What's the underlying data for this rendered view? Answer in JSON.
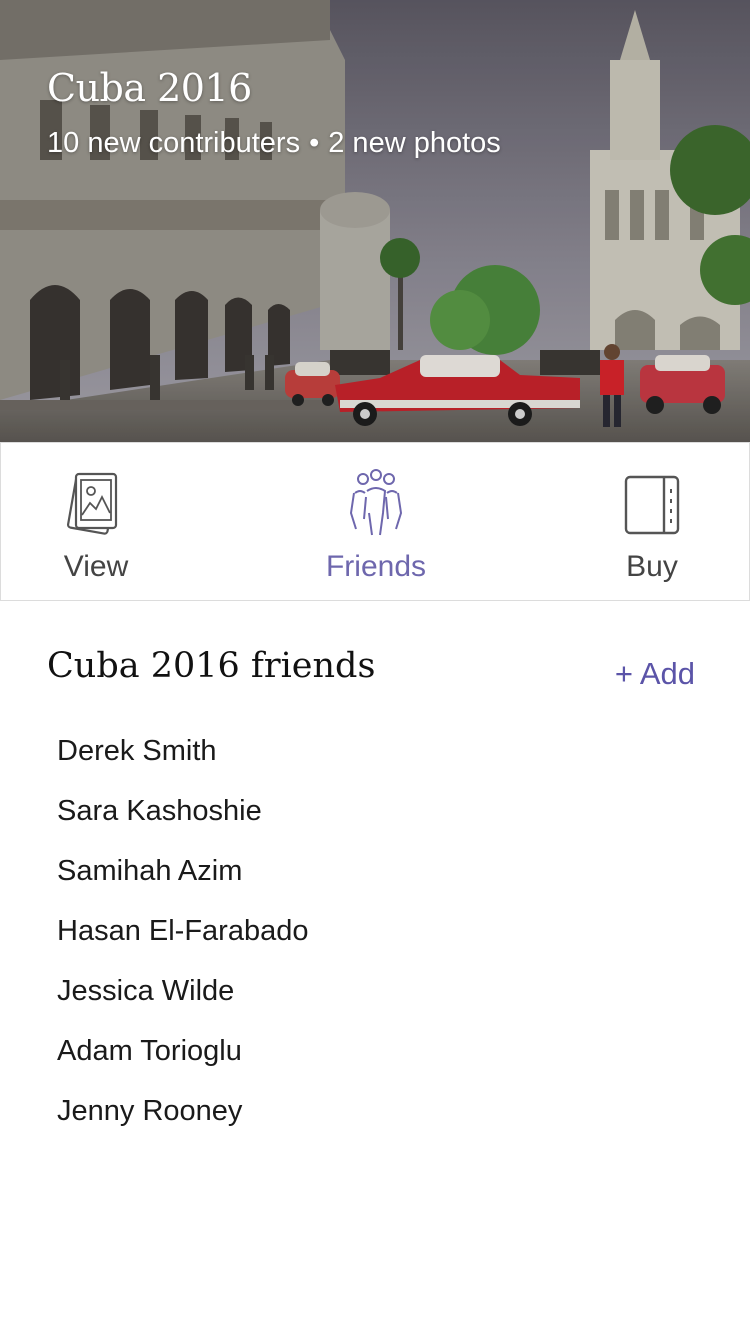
{
  "album": {
    "title": "Cuba 2016",
    "contributors_text": "10 new contributers",
    "separator": "•",
    "photos_text": "2 new photos"
  },
  "tabs": [
    {
      "label": "View",
      "icon": "photos-icon",
      "active": false
    },
    {
      "label": "Friends",
      "icon": "friends-icon",
      "active": true
    },
    {
      "label": "Buy",
      "icon": "book-icon",
      "active": false
    }
  ],
  "friends": {
    "heading": "Cuba 2016 friends",
    "add_label": "+ Add",
    "list": [
      "Derek Smith",
      "Sara Kashoshie",
      "Samihah Azim",
      "Hasan El-Farabado",
      "Jessica Wilde",
      "Adam Torioglu",
      "Jenny Rooney"
    ]
  },
  "colors": {
    "accent": "#5b54a8",
    "active_tab": "#6e67ad"
  }
}
